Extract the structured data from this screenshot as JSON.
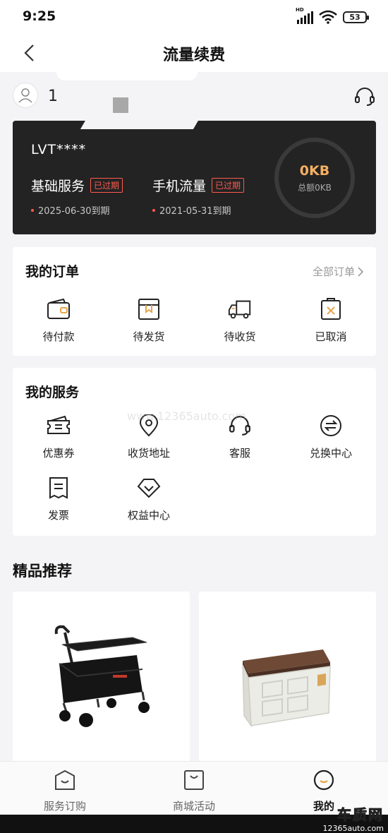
{
  "status_bar": {
    "time": "9:25",
    "battery": "53",
    "hd": "HD"
  },
  "nav": {
    "title": "流量续费"
  },
  "user": {
    "name": "1"
  },
  "vehicle_card": {
    "plate": "LVT****",
    "services": [
      {
        "name": "基础服务",
        "badge": "已过期",
        "date": "2025-06-30到期"
      },
      {
        "name": "手机流量",
        "badge": "已过期",
        "date": "2021-05-31到期"
      }
    ],
    "ring": {
      "value": "0KB",
      "label": "总额0KB"
    }
  },
  "orders": {
    "title": "我的订单",
    "more": "全部订单",
    "items": [
      {
        "label": "待付款",
        "icon": "wallet-icon"
      },
      {
        "label": "待发货",
        "icon": "package-icon"
      },
      {
        "label": "待收货",
        "icon": "truck-icon"
      },
      {
        "label": "已取消",
        "icon": "cancelled-icon"
      }
    ]
  },
  "services": {
    "title": "我的服务",
    "items": [
      {
        "label": "优惠券",
        "icon": "coupon-icon"
      },
      {
        "label": "收货地址",
        "icon": "location-icon"
      },
      {
        "label": "客服",
        "icon": "headset-icon"
      },
      {
        "label": "兑换中心",
        "icon": "exchange-icon"
      },
      {
        "label": "发票",
        "icon": "invoice-icon"
      },
      {
        "label": "权益中心",
        "icon": "benefits-icon"
      }
    ]
  },
  "recommend": {
    "title": "精品推荐"
  },
  "watermark": "www.12365auto.com",
  "tabs": [
    {
      "label": "服务订购",
      "icon": "service-tab-icon"
    },
    {
      "label": "商城活动",
      "icon": "mall-tab-icon"
    },
    {
      "label": "我的",
      "icon": "me-tab-icon"
    }
  ],
  "logo": {
    "big": "车质网",
    "small": "12365auto.com"
  }
}
